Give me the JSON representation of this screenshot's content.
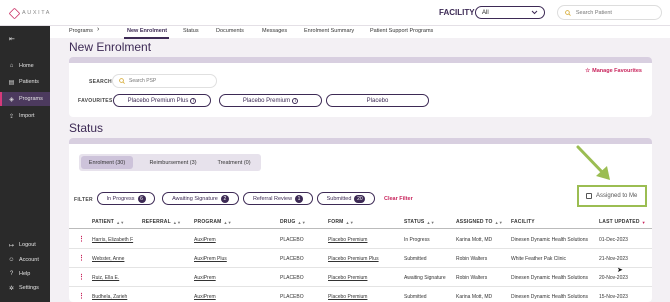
{
  "header": {
    "logo_text": "AUXITA",
    "facility_label": "FACILITY",
    "facility_value": "All",
    "search_placeholder": "Search Patient"
  },
  "sidebar": {
    "items": [
      {
        "label": "Home",
        "icon": "home-icon"
      },
      {
        "label": "Patients",
        "icon": "patients-icon"
      },
      {
        "label": "Programs",
        "icon": "programs-icon",
        "active": true
      },
      {
        "label": "Import",
        "icon": "import-icon"
      }
    ],
    "bottom_items": [
      {
        "label": "Logout",
        "icon": "logout-icon"
      },
      {
        "label": "Account",
        "icon": "account-icon"
      },
      {
        "label": "Help",
        "icon": "help-icon"
      },
      {
        "label": "Settings",
        "icon": "settings-icon"
      }
    ]
  },
  "nav": {
    "items": [
      "Programs",
      "New Enrolment",
      "Status",
      "Documents",
      "Messages",
      "Enrolment Summary",
      "Patient Support Programs"
    ],
    "active": "New Enrolment"
  },
  "enrolment": {
    "title": "New Enrolment",
    "manage_favourites": "Manage Favourites",
    "search_label": "SEARCH",
    "search_placeholder": "Search PSP",
    "favourites_label": "FAVOURITES",
    "favourites": [
      "Placebo Premium Plus",
      "Placebo Premium",
      "Placebo"
    ]
  },
  "status": {
    "title": "Status",
    "tabs": [
      {
        "label": "Enrolment (30)",
        "active": true
      },
      {
        "label": "Reimbursement (3)"
      },
      {
        "label": "Treatment (0)"
      }
    ],
    "filter_label": "FILTER",
    "filters": [
      {
        "label": "In Progress",
        "count": "6"
      },
      {
        "label": "Awaiting Signature",
        "count": "2"
      },
      {
        "label": "Referral Review",
        "count": "1"
      },
      {
        "label": "Submitted",
        "count": "20"
      }
    ],
    "clear_filter": "Clear Filter",
    "assigned_to_me": "Assigned to Me",
    "columns": [
      "PATIENT",
      "REFERRAL",
      "PROGRAM",
      "DRUG",
      "FORM",
      "STATUS",
      "ASSIGNED TO",
      "FACILITY",
      "LAST UPDATED"
    ],
    "rows": [
      {
        "patient": "Harris, Elizabeth F",
        "referral": "",
        "program": "AuxiPrem",
        "drug": "PLACEBO",
        "form": "Placebo Premium",
        "status": "In Progress",
        "assigned": "Karina Mott, MD",
        "facility": "Dinesen Dynamic Health Solutions",
        "updated": "01-Dec-2023"
      },
      {
        "patient": "Webster, Anne",
        "referral": "",
        "program": "AuxiPrem Plus",
        "drug": "PLACEBO",
        "form": "Placebo Premium Plus",
        "status": "Submitted",
        "assigned": "Robin Walters",
        "facility": "White Feather Pak Clinic",
        "updated": "21-Nov-2023"
      },
      {
        "patient": "Ruiz, Ella E.",
        "referral": "",
        "program": "AuxiPrem",
        "drug": "PLACEBO",
        "form": "Placebo Premium",
        "status": "Awaiting Signature",
        "assigned": "Robin Walters",
        "facility": "Dinesen Dynamic Health Solutions",
        "updated": "20-Nov-2023"
      },
      {
        "patient": "Budhela, Zarieh",
        "referral": "",
        "program": "AuxiPrem",
        "drug": "PLACEBO",
        "form": "Placebo Premium",
        "status": "Submitted",
        "assigned": "Karina Mott, MD",
        "facility": "Dinesen Dynamic Health Solutions",
        "updated": "15-Nov-2023"
      }
    ]
  },
  "colors": {
    "primary": "#3d2a55",
    "accent": "#c8245c",
    "highlight": "#9bbd52",
    "sidebar_bg": "#2a2a2a"
  }
}
